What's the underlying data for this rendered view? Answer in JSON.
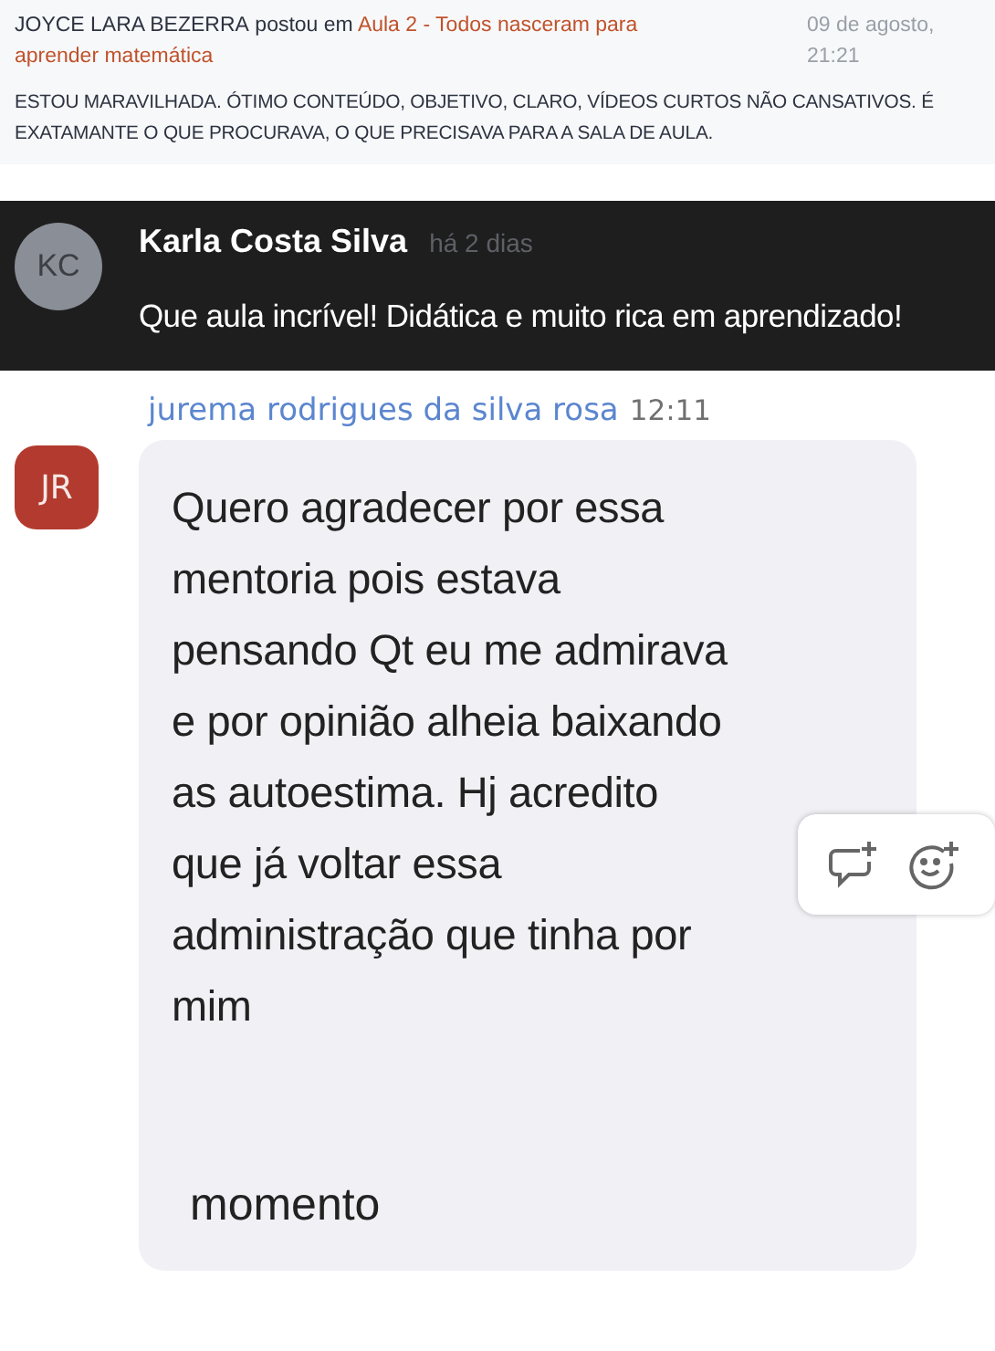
{
  "forum_post": {
    "author": "JOYCE LARA BEZERRA",
    "action": "postou em",
    "link": "Aula 2 - Todos nasceram para aprender matemática",
    "date": "09 de agosto,",
    "time": "21:21",
    "body": "ESTOU MARAVILHADA. ÓTIMO CONTEÚDO, OBJETIVO, CLARO, VÍDEOS CURTOS NÃO CANSATIVOS. É EXATAMANTE O QUE PROCURAVA, O QUE PRECISAVA PARA A SALA DE AULA."
  },
  "comment": {
    "initials": "KC",
    "author": "Karla Costa Silva",
    "time": "há 2 dias",
    "body": "Que aula incrível! Didática e muito rica em aprendizado!"
  },
  "chat_message": {
    "author": "jurema rodrigues da silva rosa",
    "time": "12:11",
    "initials": "JR",
    "lines": [
      "Quero agradecer por essa",
      "mentoria pois estava",
      "pensando Qt eu me admirava",
      "e por opinião alheia baixando",
      "as autoestima. Hj acredito",
      "que já voltar essa",
      "administração que tinha por",
      "mim"
    ],
    "tail": "momento"
  }
}
